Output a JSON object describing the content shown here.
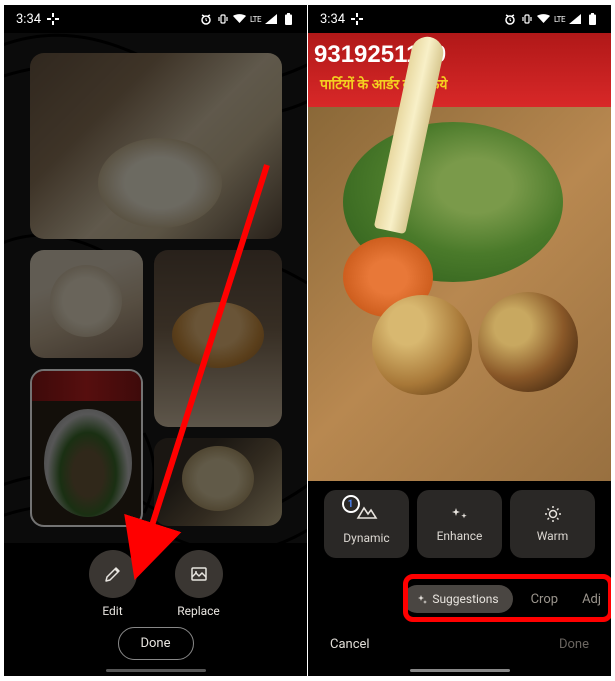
{
  "status": {
    "time": "3:34",
    "lte": "LTE"
  },
  "left": {
    "edit": "Edit",
    "replace": "Replace",
    "done": "Done"
  },
  "right": {
    "banner_number": "9319251189",
    "banner_sub": "पार्टियों के आर्डर बुक किये",
    "dynamic": "Dynamic",
    "dynamic_badge": "1",
    "enhance": "Enhance",
    "warm": "Warm",
    "suggestions": "Suggestions",
    "crop": "Crop",
    "adjust": "Adj",
    "cancel": "Cancel",
    "done": "Done"
  }
}
